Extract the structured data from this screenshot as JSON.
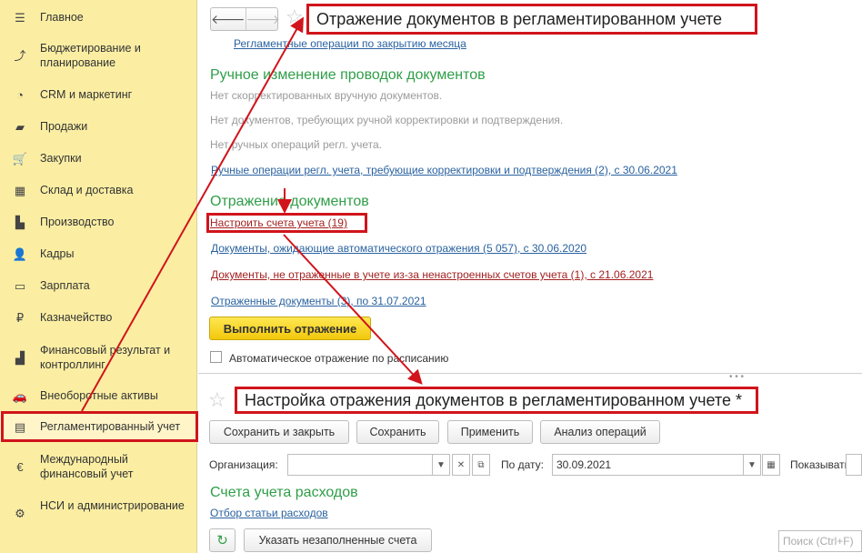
{
  "sidebar": {
    "items": [
      {
        "icon": "menu-icon",
        "glyph": "☰",
        "label": "Главное"
      },
      {
        "icon": "budget-icon",
        "glyph": "⤴",
        "label": "Бюджетирование и планирование"
      },
      {
        "icon": "crm-icon",
        "glyph": "◔",
        "label": "CRM и маркетинг"
      },
      {
        "icon": "sales-bag-icon",
        "glyph": "▰",
        "label": "Продажи"
      },
      {
        "icon": "cart-icon",
        "glyph": "🛒",
        "label": "Закупки"
      },
      {
        "icon": "warehouse-icon",
        "glyph": "▦",
        "label": "Склад и доставка"
      },
      {
        "icon": "factory-icon",
        "glyph": "▙",
        "label": "Производство"
      },
      {
        "icon": "person-icon",
        "glyph": "👤",
        "label": "Кадры"
      },
      {
        "icon": "salary-icon",
        "glyph": "▭",
        "label": "Зарплата"
      },
      {
        "icon": "treasury-icon",
        "glyph": "₽",
        "label": "Казначейство"
      },
      {
        "icon": "finance-icon",
        "glyph": "▟",
        "label": "Финансовый результат и контроллинг"
      },
      {
        "icon": "car-icon",
        "glyph": "🚗",
        "label": "Внеоборотные активы"
      },
      {
        "icon": "ledger-icon",
        "glyph": "▤",
        "label": "Регламентированный учет"
      },
      {
        "icon": "euro-icon",
        "glyph": "€",
        "label": "Международный финансовый учет"
      },
      {
        "icon": "gear-icon",
        "glyph": "⚙",
        "label": "НСИ и администрирование"
      }
    ]
  },
  "upper": {
    "back_glyph": "🡐",
    "forward_glyph": "🡒",
    "star_glyph": "☆",
    "title": "Отражение документов в регламентированном учете",
    "breadcrumb_link": "Регламентные операции по закрытию месяца",
    "section1_title": "Ручное изменение проводок документов",
    "muted1": "Нет скорректированных вручную документов.",
    "muted2": "Нет документов, требующих ручной корректировки и подтверждения.",
    "muted3": "Нет ручных операций регл. учета.",
    "manual_ops_link": "Ручные операции регл. учета, требующие корректировки и подтверждения (2), с 30.06.2021",
    "section2_title": "Отражение документов",
    "configure_accounts_link": "Настроить счета учета (19)",
    "awaiting_link": "Документы, ожидающие автоматического отражения (5 057), с 30.06.2020",
    "not_reflected_link": "Документы, не отраженные в учете из-за ненастроенных счетов учета (1), с 21.06.2021",
    "reflected_link": "Отраженные документы (3), по 31.07.2021",
    "execute_button": "Выполнить отражение",
    "auto_checkbox_label": "Автоматическое отражение по расписанию"
  },
  "lower": {
    "title": "Настройка отражения документов в регламентированном учете *",
    "buttons": {
      "save_close": "Сохранить и закрыть",
      "save": "Сохранить",
      "apply": "Применить",
      "analyze": "Анализ операций"
    },
    "org_label": "Организация:",
    "org_value": "",
    "date_label": "По дату:",
    "date_value": "30.09.2021",
    "show_label": "Показывать:",
    "section_title": "Счета учета расходов",
    "expense_filter_link": "Отбор статьи расходов",
    "fill_unfilled_button": "Указать незаполненные счета",
    "search_placeholder": "Поиск (Ctrl+F)"
  },
  "colors": {
    "sidebar_bg": "#fbeea3",
    "highlight_red": "#d1141b",
    "section_green": "#2f9e48",
    "link_blue": "#2a62a0",
    "link_red": "#a32020",
    "primary_yellow": "#f2c80d"
  }
}
